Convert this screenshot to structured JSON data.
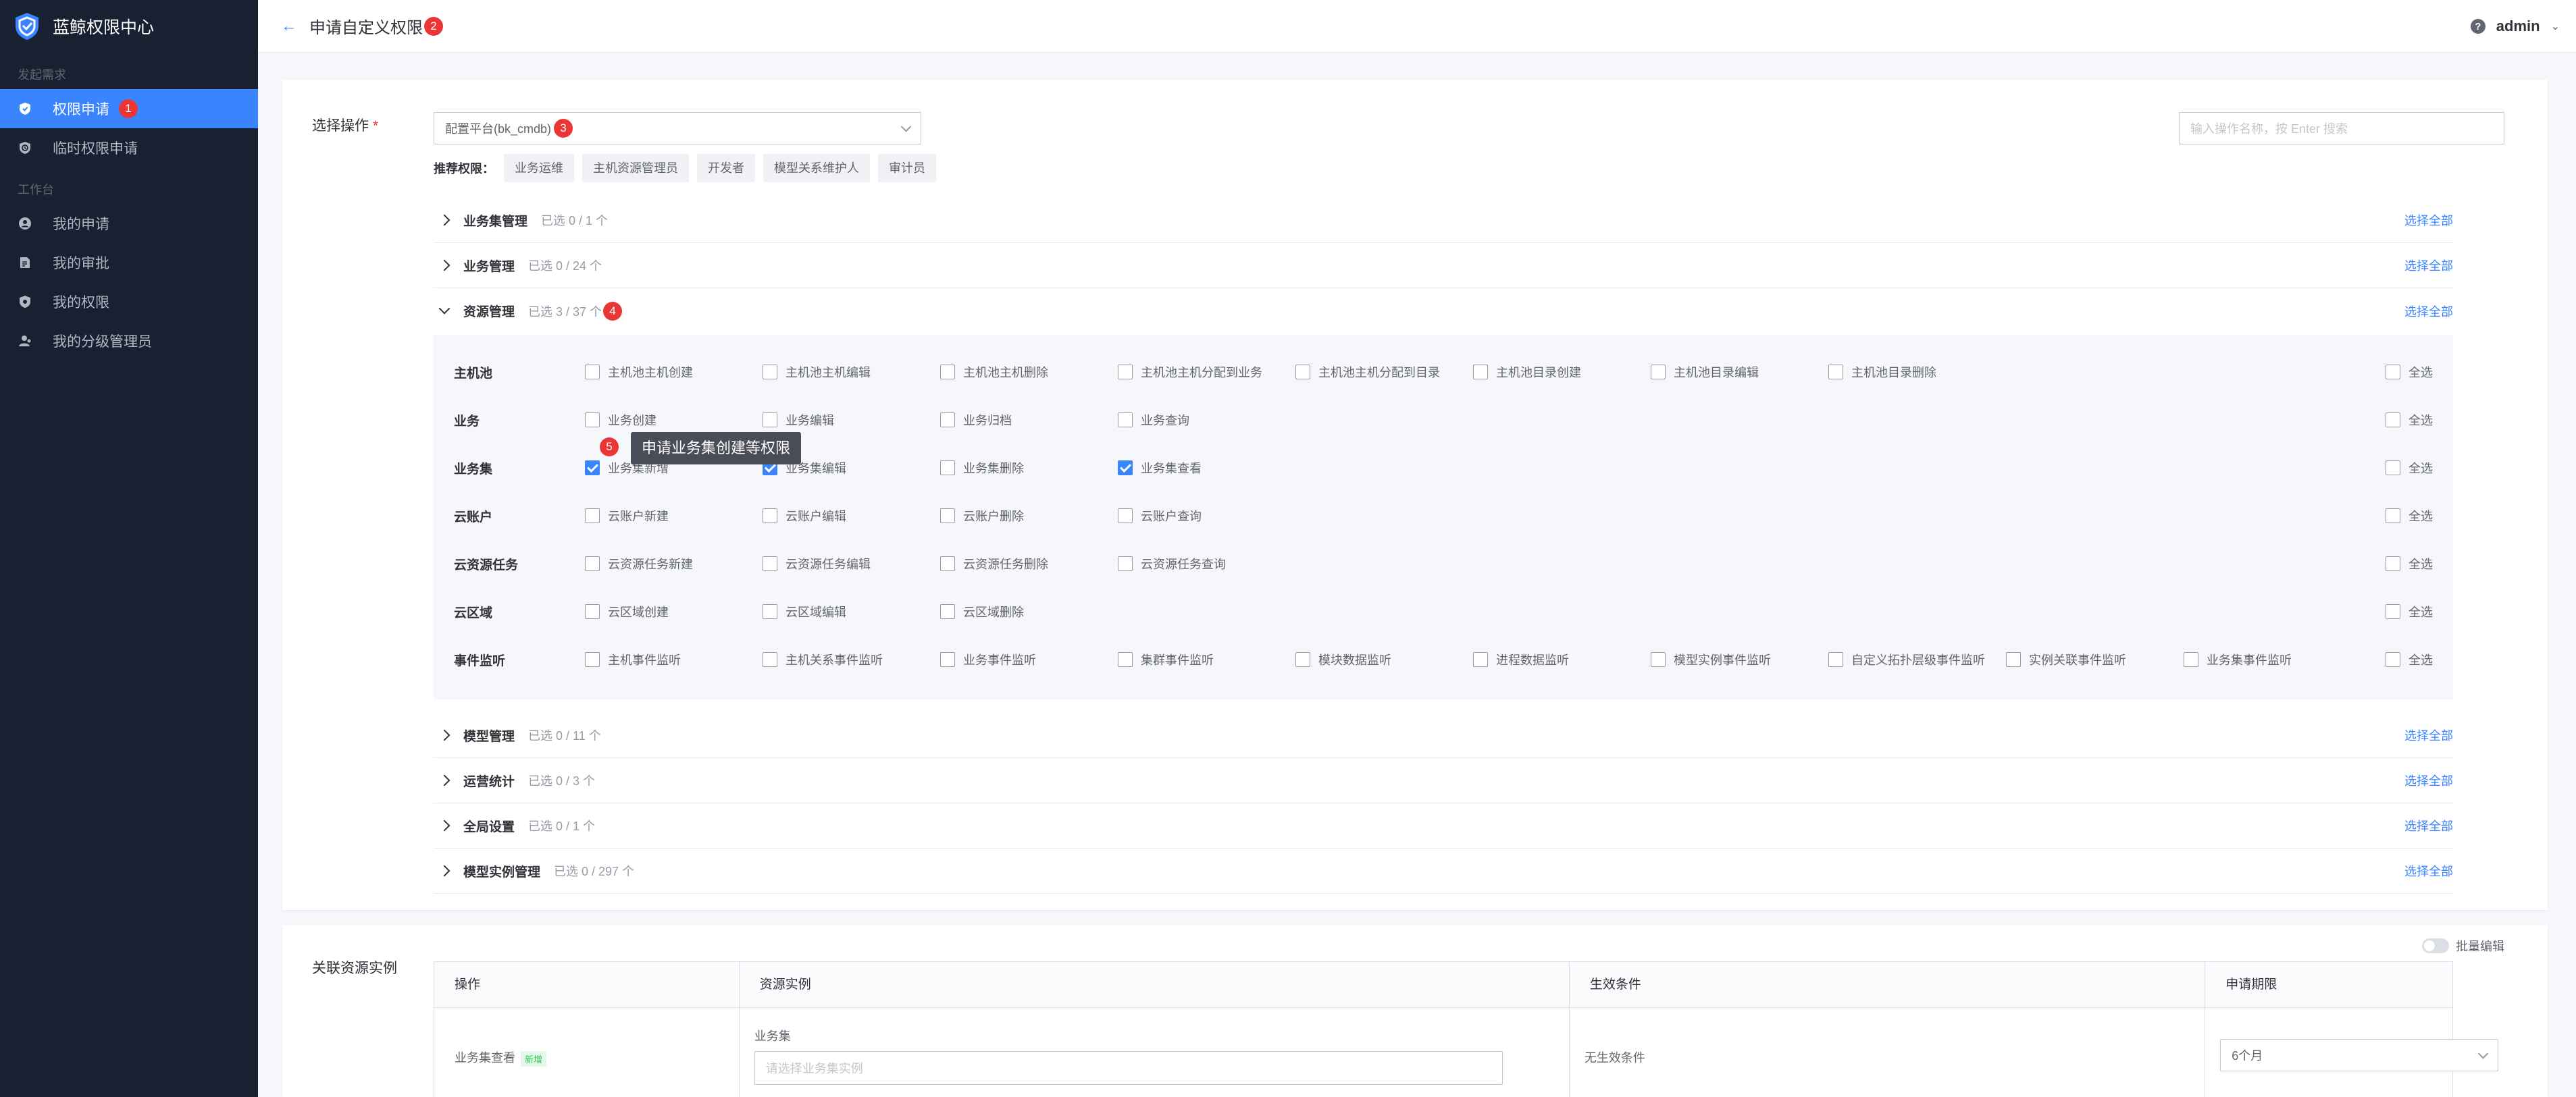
{
  "sidebar": {
    "brand": "蓝鲸权限中心",
    "group1": "发起需求",
    "group2": "工作台",
    "items": [
      {
        "label": "权限申请",
        "badge": "1"
      },
      {
        "label": "临时权限申请"
      },
      {
        "label": "我的申请"
      },
      {
        "label": "我的审批"
      },
      {
        "label": "我的权限"
      },
      {
        "label": "我的分级管理员"
      }
    ]
  },
  "header": {
    "back": "←",
    "title": "申请自定义权限",
    "badge": "2",
    "user": "admin",
    "help": "?"
  },
  "actions": {
    "label": "选择操作",
    "required": "*",
    "system_value": "配置平台(bk_cmdb)",
    "system_badge": "3",
    "search_placeholder": "输入操作名称，按 Enter 搜索",
    "recommend_label": "推荐权限：",
    "recommend_tags": [
      "业务运维",
      "主机资源管理员",
      "开发者",
      "模型关系维护人",
      "审计员"
    ],
    "select_all": "选择全部",
    "row_all": "全选",
    "categories": [
      {
        "name": "业务集管理",
        "count": "已选 0 / 1 个"
      },
      {
        "name": "业务管理",
        "count": "已选 0 / 24 个"
      },
      {
        "name": "资源管理",
        "count": "已选 3 / 37 个",
        "badge": "4"
      },
      {
        "name": "模型管理",
        "count": "已选 0 / 11 个"
      },
      {
        "name": "运营统计",
        "count": "已选 0 / 3 个"
      },
      {
        "name": "全局设置",
        "count": "已选 0 / 1 个"
      },
      {
        "name": "模型实例管理",
        "count": "已选 0 / 297 个"
      }
    ],
    "groups": [
      {
        "name": "主机池",
        "options": [
          "主机池主机创建",
          "主机池主机编辑",
          "主机池主机删除",
          "主机池主机分配到业务",
          "主机池主机分配到目录",
          "主机池目录创建",
          "主机池目录编辑",
          "主机池目录删除"
        ]
      },
      {
        "name": "业务",
        "options": [
          "业务创建",
          "业务编辑",
          "业务归档",
          "业务查询"
        ]
      },
      {
        "name": "业务集",
        "options": [
          "业务集新增",
          "业务集编辑",
          "业务集删除",
          "业务集查看"
        ]
      },
      {
        "name": "云账户",
        "options": [
          "云账户新建",
          "云账户编辑",
          "云账户删除",
          "云账户查询"
        ]
      },
      {
        "name": "云资源任务",
        "options": [
          "云资源任务新建",
          "云资源任务编辑",
          "云资源任务删除",
          "云资源任务查询"
        ]
      },
      {
        "name": "云区域",
        "options": [
          "云区域创建",
          "云区域编辑",
          "云区域删除"
        ]
      },
      {
        "name": "事件监听",
        "options": [
          "主机事件监听",
          "主机关系事件监听",
          "业务事件监听",
          "集群事件监听",
          "模块数据监听",
          "进程数据监听",
          "模型实例事件监听",
          "自定义拓扑层级事件监听",
          "实例关联事件监听",
          "业务集事件监听"
        ]
      }
    ],
    "tooltip": "申请业务集创建等权限",
    "tooltip_badge": "5"
  },
  "resources": {
    "label": "关联资源实例",
    "batch_edit": "批量编辑",
    "headers": [
      "操作",
      "资源实例",
      "生效条件",
      "申请期限"
    ],
    "row": {
      "action": "业务集查看",
      "new_tag": "新增",
      "resource_type": "业务集",
      "resource_placeholder": "请选择业务集实例",
      "condition": "无生效条件",
      "period": "6个月"
    }
  }
}
